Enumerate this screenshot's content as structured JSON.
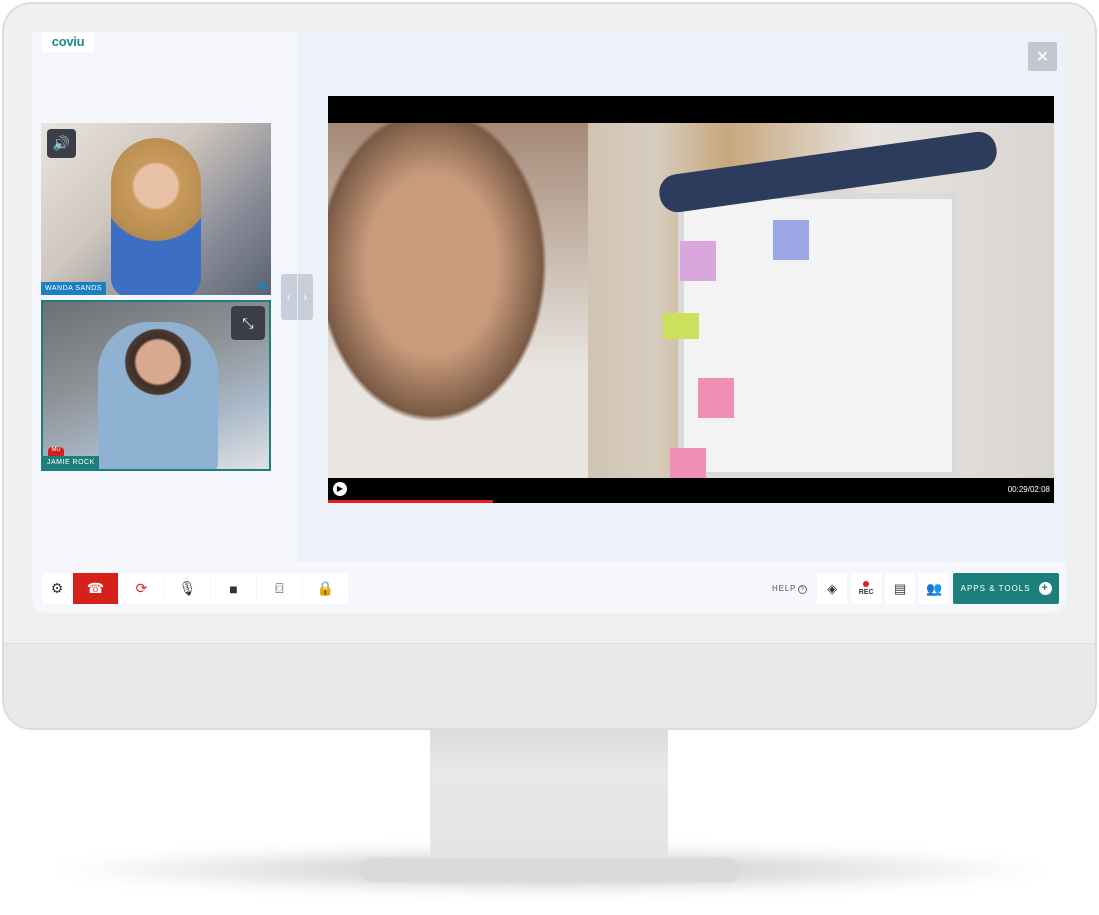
{
  "app": {
    "logo": "coviu"
  },
  "participants": [
    {
      "name": "WANDA SANDS",
      "label_color": "#1b7fc0",
      "icon": "speaker-icon"
    },
    {
      "name": "JAMIE ROCK",
      "label_color": "#1d7f7c",
      "icon": "minimize-icon",
      "badge": "MU"
    }
  ],
  "pager": {
    "prev": "‹",
    "next": "›"
  },
  "stage": {
    "close": "✕"
  },
  "video": {
    "time": "00:29/02:08",
    "progress": 0.227,
    "progress_color": "#ee1c1c"
  },
  "toolbar": {
    "left": [
      {
        "name": "settings",
        "glyph": "⚙"
      },
      {
        "name": "end-call",
        "glyph": "☎"
      },
      {
        "name": "refresh",
        "glyph": "⟳"
      },
      {
        "name": "microphone",
        "glyph": "🎙"
      },
      {
        "name": "camera",
        "glyph": "■"
      },
      {
        "name": "switch-camera",
        "glyph": "⌼"
      },
      {
        "name": "lock",
        "glyph": "🔒"
      }
    ],
    "help": "HELP",
    "help_icon": "?",
    "layers": "◈",
    "rec": "REC",
    "chat": "▤",
    "people": "👥",
    "apps_label": "APPS & TOOLS",
    "apps_icon": "+"
  },
  "colors": {
    "accent": "#1d7f7c",
    "end_call": "#d4211a"
  }
}
